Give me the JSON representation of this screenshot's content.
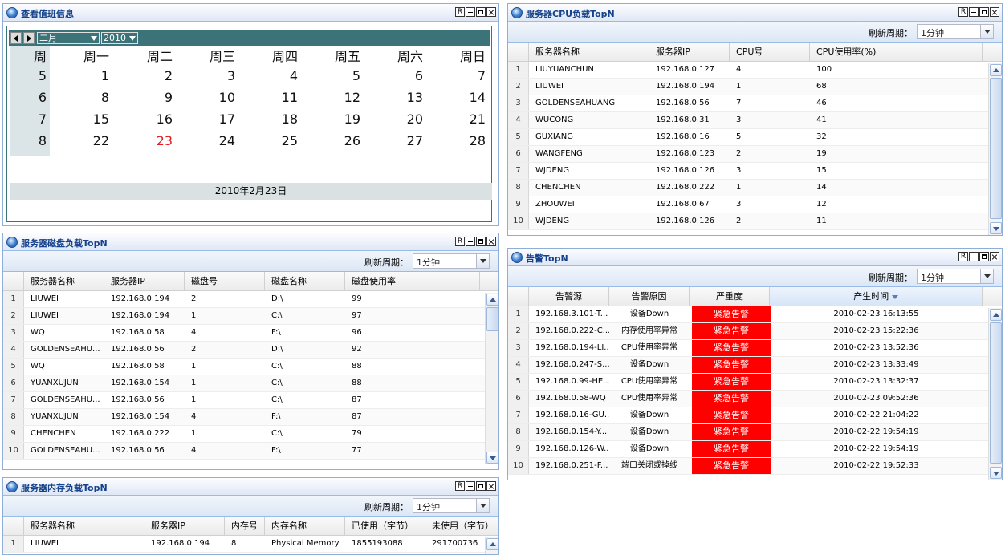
{
  "calendar": {
    "title": "查看值班信息",
    "month": "二月",
    "year": "2010",
    "week_header": "周",
    "days": [
      "周一",
      "周二",
      "周三",
      "周四",
      "周五",
      "周六",
      "周日"
    ],
    "weeks": [
      {
        "wk": "5",
        "d": [
          "1",
          "2",
          "3",
          "4",
          "5",
          "6",
          "7"
        ]
      },
      {
        "wk": "6",
        "d": [
          "8",
          "9",
          "10",
          "11",
          "12",
          "13",
          "14"
        ]
      },
      {
        "wk": "7",
        "d": [
          "15",
          "16",
          "17",
          "18",
          "19",
          "20",
          "21"
        ]
      },
      {
        "wk": "8",
        "d": [
          "22",
          "23",
          "24",
          "25",
          "26",
          "27",
          "28"
        ]
      }
    ],
    "today": "23",
    "today_color": "#e02020",
    "footer": "2010年2月23日"
  },
  "cpu": {
    "title": "服务器CPU负载TopN",
    "refresh_label": "刷新周期：",
    "refresh_value": "1分钟",
    "columns": [
      "服务器名称",
      "服务器IP",
      "CPU号",
      "CPU使用率(%)"
    ],
    "rows": [
      [
        "1",
        "LIUYUANCHUN",
        "192.168.0.127",
        "4",
        "100"
      ],
      [
        "2",
        "LIUWEI",
        "192.168.0.194",
        "1",
        "68"
      ],
      [
        "3",
        "GOLDENSEAHUANG",
        "192.168.0.56",
        "7",
        "46"
      ],
      [
        "4",
        "WUCONG",
        "192.168.0.31",
        "3",
        "41"
      ],
      [
        "5",
        "GUXIANG",
        "192.168.0.16",
        "5",
        "32"
      ],
      [
        "6",
        "WANGFENG",
        "192.168.0.123",
        "2",
        "19"
      ],
      [
        "7",
        "WJDENG",
        "192.168.0.126",
        "3",
        "15"
      ],
      [
        "8",
        "CHENCHEN",
        "192.168.0.222",
        "1",
        "14"
      ],
      [
        "9",
        "ZHOUWEI",
        "192.168.0.67",
        "3",
        "12"
      ],
      [
        "10",
        "WJDENG",
        "192.168.0.126",
        "2",
        "11"
      ]
    ]
  },
  "disk": {
    "title": "服务器磁盘负载TopN",
    "refresh_label": "刷新周期：",
    "refresh_value": "1分钟",
    "columns": [
      "服务器名称",
      "服务器IP",
      "磁盘号",
      "磁盘名称",
      "磁盘使用率"
    ],
    "rows": [
      [
        "1",
        "LIUWEI",
        "192.168.0.194",
        "2",
        "D:\\",
        "99"
      ],
      [
        "2",
        "LIUWEI",
        "192.168.0.194",
        "1",
        "C:\\",
        "97"
      ],
      [
        "3",
        "WQ",
        "192.168.0.58",
        "4",
        "F:\\",
        "96"
      ],
      [
        "4",
        "GOLDENSEAHU...",
        "192.168.0.56",
        "2",
        "D:\\",
        "92"
      ],
      [
        "5",
        "WQ",
        "192.168.0.58",
        "1",
        "C:\\",
        "88"
      ],
      [
        "6",
        "YUANXUJUN",
        "192.168.0.154",
        "1",
        "C:\\",
        "88"
      ],
      [
        "7",
        "GOLDENSEAHU...",
        "192.168.0.56",
        "1",
        "C:\\",
        "87"
      ],
      [
        "8",
        "YUANXUJUN",
        "192.168.0.154",
        "4",
        "F:\\",
        "87"
      ],
      [
        "9",
        "CHENCHEN",
        "192.168.0.222",
        "1",
        "C:\\",
        "79"
      ],
      [
        "10",
        "GOLDENSEAHU...",
        "192.168.0.56",
        "4",
        "F:\\",
        "77"
      ]
    ]
  },
  "alarm": {
    "title": "告警TopN",
    "refresh_label": "刷新周期：",
    "refresh_value": "1分钟",
    "columns": [
      "告警源",
      "告警原因",
      "严重度",
      "产生时间"
    ],
    "severity_color": "#ff0000",
    "rows": [
      [
        "1",
        "192.168.3.101-T...",
        "设备Down",
        "紧急告警",
        "2010-02-23 16:13:55"
      ],
      [
        "2",
        "192.168.0.222-C...",
        "内存使用率异常",
        "紧急告警",
        "2010-02-23 15:22:36"
      ],
      [
        "3",
        "192.168.0.194-LI...",
        "CPU使用率异常",
        "紧急告警",
        "2010-02-23 13:52:36"
      ],
      [
        "4",
        "192.168.0.247-S...",
        "设备Down",
        "紧急告警",
        "2010-02-23 13:33:49"
      ],
      [
        "5",
        "192.168.0.99-HE...",
        "CPU使用率异常",
        "紧急告警",
        "2010-02-23 13:32:37"
      ],
      [
        "6",
        "192.168.0.58-WQ",
        "CPU使用率异常",
        "紧急告警",
        "2010-02-23 09:52:36"
      ],
      [
        "7",
        "192.168.0.16-GU...",
        "设备Down",
        "紧急告警",
        "2010-02-22 21:04:22"
      ],
      [
        "8",
        "192.168.0.154-Y...",
        "设备Down",
        "紧急告警",
        "2010-02-22 19:54:19"
      ],
      [
        "9",
        "192.168.0.126-W...",
        "设备Down",
        "紧急告警",
        "2010-02-22 19:54:19"
      ],
      [
        "10",
        "192.168.0.251-F...",
        "端口关闭或掉线",
        "紧急告警",
        "2010-02-22 19:52:33"
      ]
    ]
  },
  "mem": {
    "title": "服务器内存负载TopN",
    "refresh_label": "刷新周期：",
    "refresh_value": "1分钟",
    "columns": [
      "服务器名称",
      "服务器IP",
      "内存号",
      "内存名称",
      "已使用（字节）",
      "未使用（字节）"
    ],
    "rows": [
      [
        "1",
        "LIUWEI",
        "192.168.0.194",
        "8",
        "Physical Memory",
        "1855193088",
        "291700736"
      ]
    ]
  },
  "tool_labels": {
    "refresh": "R"
  }
}
